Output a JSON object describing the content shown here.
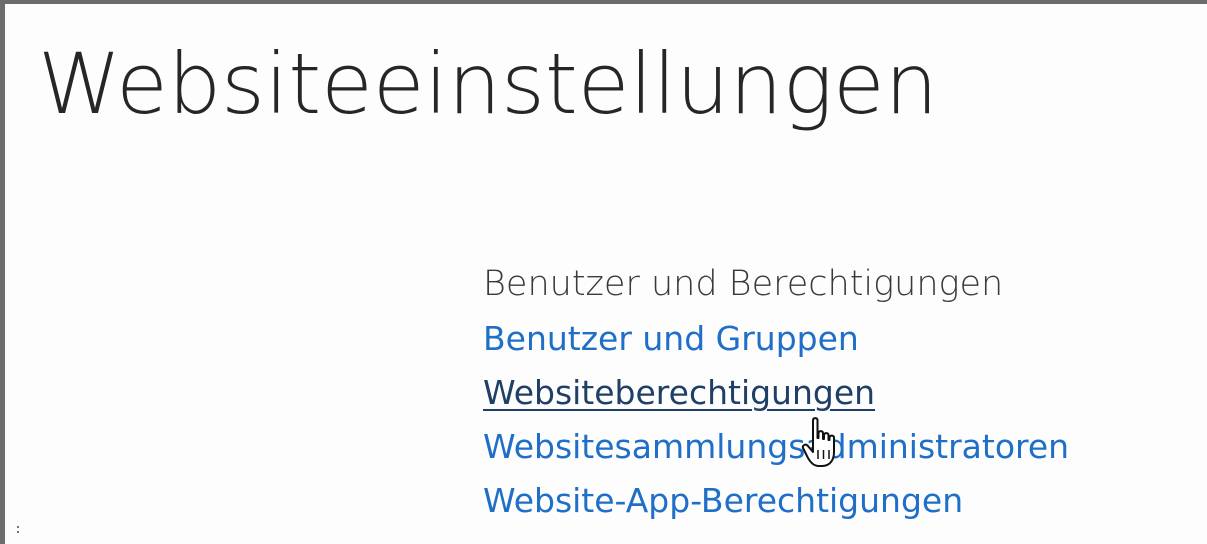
{
  "page": {
    "title": "Websiteeinstellungen"
  },
  "section": {
    "heading": "Benutzer und Berechtigungen",
    "links": [
      {
        "label": "Benutzer und Gruppen",
        "hovered": false
      },
      {
        "label": "Websiteberechtigungen",
        "hovered": true
      },
      {
        "label": "Websitesammlungsadministratoren",
        "hovered": false
      },
      {
        "label": "Website-App-Berechtigungen",
        "hovered": false
      }
    ]
  },
  "colors": {
    "link": "#1f6ec7",
    "link_hover": "#1f3f66",
    "heading": "#3a3a3a",
    "title": "#262626",
    "frame_border": "#6d6d6d"
  },
  "icons": {
    "cursor": "hand-pointer-icon"
  }
}
